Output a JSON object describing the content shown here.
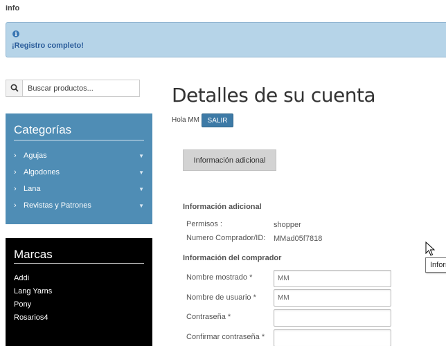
{
  "header": {
    "info_label": "info"
  },
  "alert": {
    "message": "¡Registro completo!"
  },
  "search": {
    "placeholder": "Buscar productos..."
  },
  "categories": {
    "title": "Categorías",
    "items": [
      {
        "label": "Agujas"
      },
      {
        "label": "Algodones"
      },
      {
        "label": "Lana"
      },
      {
        "label": "Revistas y Patrones"
      }
    ]
  },
  "brands": {
    "title": "Marcas",
    "items": [
      {
        "label": "Addi"
      },
      {
        "label": "Lang Yarns"
      },
      {
        "label": "Pony"
      },
      {
        "label": "Rosarios4"
      }
    ]
  },
  "main": {
    "title": "Detalles de su cuenta",
    "greeting": "Hola MM",
    "logout_label": "SALIR",
    "tab_label": "Información adicional",
    "info_section": {
      "heading": "Información adicional",
      "rows": [
        {
          "label": "Permisos :",
          "value": "shopper"
        },
        {
          "label": "Numero Comprador/ID:",
          "value": "MMad05f7818"
        }
      ]
    },
    "buyer_section": {
      "heading": "Información del comprador",
      "fields": [
        {
          "label": "Nombre mostrado *",
          "value": "MM"
        },
        {
          "label": "Nombre de usuario *",
          "value": "MM"
        },
        {
          "label": "Contraseña *",
          "value": ""
        },
        {
          "label": "Confirmar contraseña *",
          "value": ""
        }
      ]
    }
  },
  "tooltip": {
    "text": "Inform"
  }
}
